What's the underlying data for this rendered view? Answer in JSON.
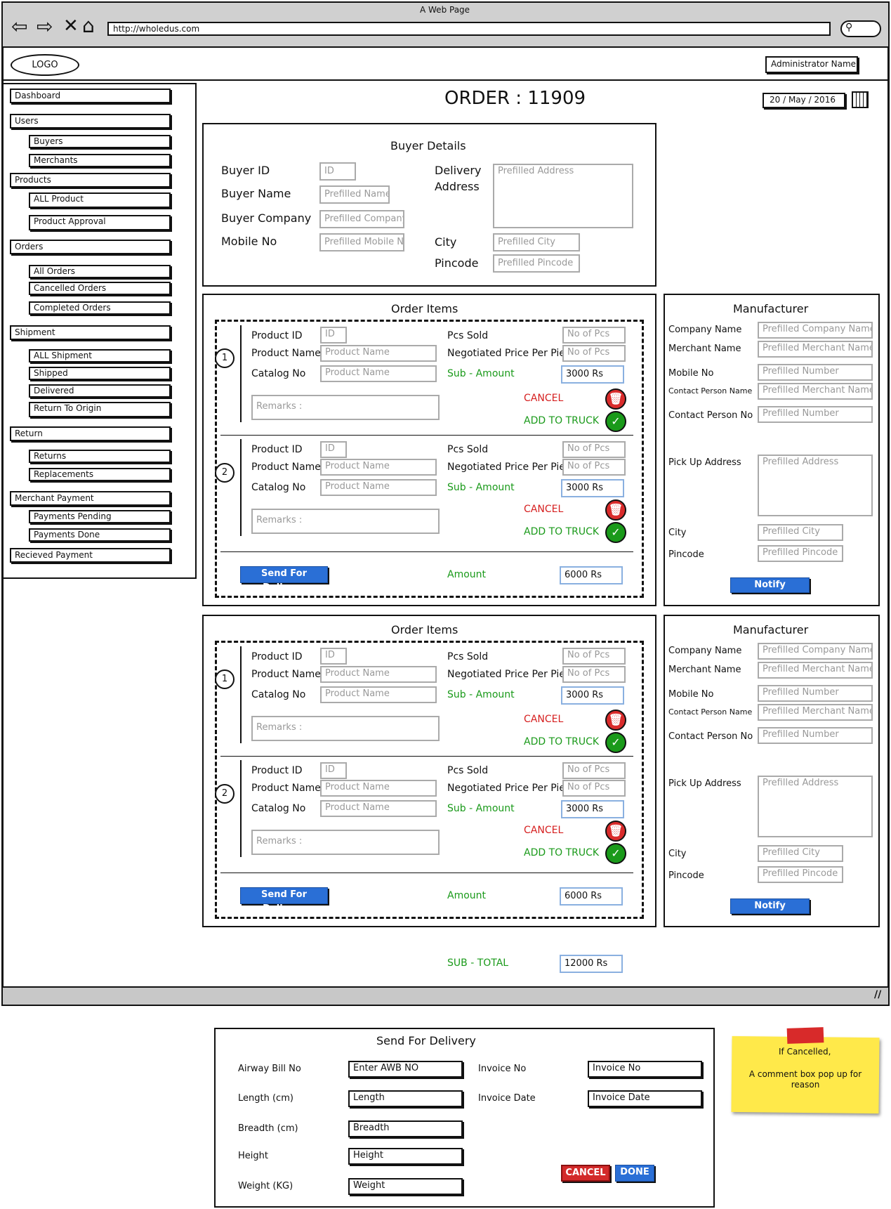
{
  "browser": {
    "title": "A Web Page",
    "url": "http://wholedus.com"
  },
  "header": {
    "logo": "LOGO",
    "admin": "Administrator Name"
  },
  "sidebar": {
    "items": [
      {
        "label": "Dashboard"
      },
      {
        "label": "Users",
        "children": [
          "Buyers",
          "Merchants"
        ]
      },
      {
        "label": "Products",
        "children": [
          "ALL Product",
          "Product Approval"
        ]
      },
      {
        "label": "Orders",
        "children": [
          "All Orders",
          "Cancelled Orders",
          "Completed Orders"
        ]
      },
      {
        "label": "Shipment",
        "children": [
          "ALL Shipment",
          "Shipped",
          "Delivered",
          "Return To Origin"
        ]
      },
      {
        "label": "Return",
        "children": [
          "Returns",
          "Replacements"
        ]
      },
      {
        "label": "Merchant Payment",
        "children": [
          "Payments Pending",
          "Payments Done"
        ]
      },
      {
        "label": "Recieved Payment"
      }
    ]
  },
  "order": {
    "title": "ORDER : 11909",
    "date": "20 / May  / 2016"
  },
  "buyer": {
    "heading": "Buyer Details",
    "id_label": "Buyer ID",
    "id_value": "ID",
    "name_label": "Buyer Name",
    "name_value": "Prefilled Name",
    "company_label": "Buyer Company",
    "company_value": "Prefilled Company",
    "mobile_label": "Mobile No",
    "mobile_value": "Prefilled Mobile No",
    "address_label_1": "Delivery",
    "address_label_2": "Address",
    "address_value": "Prefilled Address",
    "city_label": "City",
    "city_value": "Prefilled City",
    "pincode_label": "Pincode",
    "pincode_value": "Prefilled Pincode"
  },
  "item_labels": {
    "heading": "Order Items",
    "product_id": "Product ID",
    "product_id_value": "ID",
    "product_name": "Product Name",
    "product_name_value": "Product Name",
    "catalog": "Catalog No",
    "catalog_value": "Product Name",
    "pcs_sold": "Pcs Sold",
    "pcs_value": "No of Pcs",
    "neg_price": "Negotiated Price Per Piec",
    "neg_value": "No of Pcs",
    "sub_amount": "Sub - Amount",
    "sub_value": "3000 Rs",
    "remarks": "Remarks :",
    "cancel": "CANCEL",
    "add_truck": "ADD TO TRUCK",
    "item_numbers": [
      "1",
      "2"
    ],
    "send": "Send For Delivery",
    "amount": "Amount",
    "amount_value": "6000 Rs"
  },
  "manufacturer": {
    "heading": "Manufacturer",
    "company_label": "Company Name",
    "company_value": "Prefilled Company Name",
    "merchant_label": "Merchant Name",
    "merchant_value": "Prefilled Merchant Name",
    "mobile_label": "Mobile No",
    "mobile_value": "Prefilled Number",
    "contact_name_label": "Contact Person Name",
    "contact_name_value": "Prefilled Merchant Name",
    "contact_no_label": "Contact Person No",
    "contact_no_value": "Prefilled Number",
    "pickup_label": "Pick Up Address",
    "pickup_value": "Prefilled Address",
    "city_label": "City",
    "city_value": "Prefilled City",
    "pincode_label": "Pincode",
    "pincode_value": "Prefilled Pincode",
    "notify": "Notify Merchant"
  },
  "subtotal": {
    "label": "SUB - TOTAL",
    "value": "12000 Rs"
  },
  "delivery": {
    "heading": "Send For Delivery",
    "awb_label": "Airway Bill No",
    "awb_value": "Enter AWB NO",
    "length_label": "Length (cm)",
    "length_value": "Length",
    "breadth_label": "Breadth (cm)",
    "breadth_value": "Breadth",
    "height_label": "Height",
    "height_value": "Height",
    "weight_label": "Weight (KG)",
    "weight_value": "Weight",
    "invoice_no_label": "Invoice No",
    "invoice_no_value": "Invoice No",
    "invoice_date_label": "Invoice Date",
    "invoice_date_value": "Invoice Date",
    "cancel": "CANCEL",
    "done": "DONE"
  },
  "note": {
    "line1": "If Cancelled,",
    "line2": "A comment box pop up for reason"
  },
  "colors": {
    "accent_blue": "#2a6fd6",
    "cancel_red": "#d32a2a",
    "confirm_green": "#1a9a1a",
    "note_yellow": "#ffe94a"
  }
}
